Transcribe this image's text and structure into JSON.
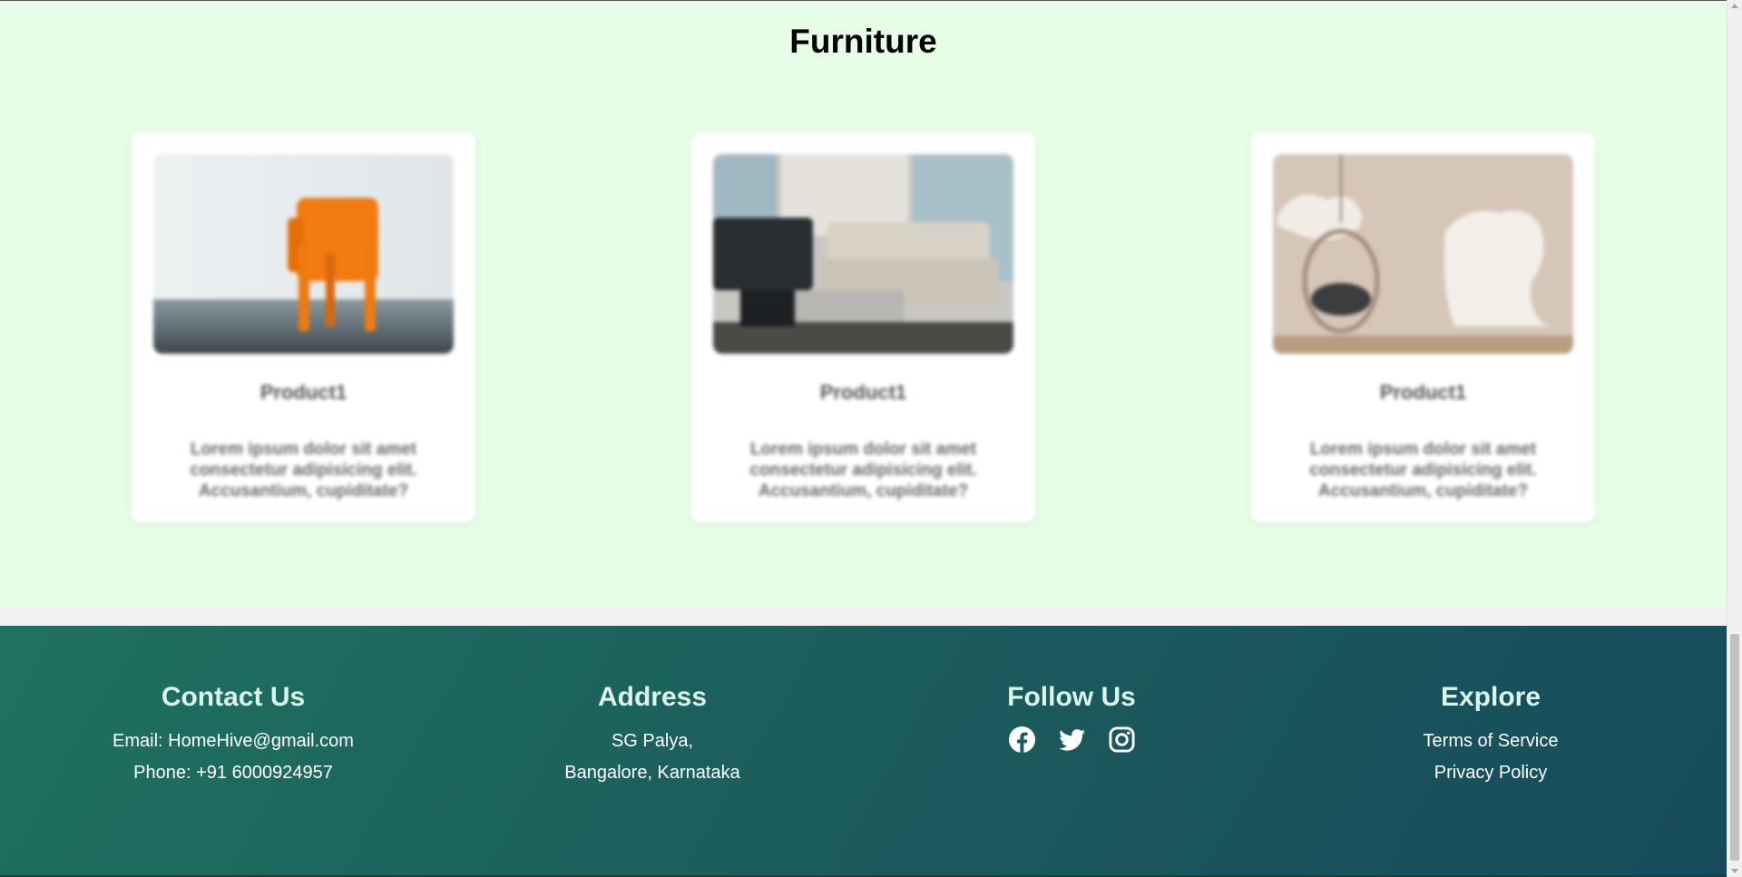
{
  "section": {
    "title": "Furniture"
  },
  "products": [
    {
      "title": "Product1",
      "description": "Lorem ipsum dolor sit amet consectetur adipisicing elit. Accusantium, cupiditate?",
      "image": "orange-chair-image"
    },
    {
      "title": "Product1",
      "description": "Lorem ipsum dolor sit amet consectetur adipisicing elit. Accusantium, cupiditate?",
      "image": "living-room-sofa-image"
    },
    {
      "title": "Product1",
      "description": "Lorem ipsum dolor sit amet consectetur adipisicing elit. Accusantium, cupiditate?",
      "image": "hanging-chair-image"
    }
  ],
  "footer": {
    "contact": {
      "heading": "Contact Us",
      "email": "Email: HomeHive@gmail.com",
      "phone": "Phone: +91 6000924957"
    },
    "address": {
      "heading": "Address",
      "line1": "SG Palya,",
      "line2": "Bangalore, Karnataka"
    },
    "follow": {
      "heading": "Follow Us",
      "icons": [
        "facebook-icon",
        "twitter-icon",
        "instagram-icon"
      ]
    },
    "explore": {
      "heading": "Explore",
      "links": [
        "Terms of Service",
        "Privacy Policy"
      ]
    }
  },
  "colors": {
    "section_bg": "#e6fde6",
    "footer_start": "#1f7260",
    "footer_end": "#174b5c",
    "heading_tint": "#d9f5ea"
  }
}
